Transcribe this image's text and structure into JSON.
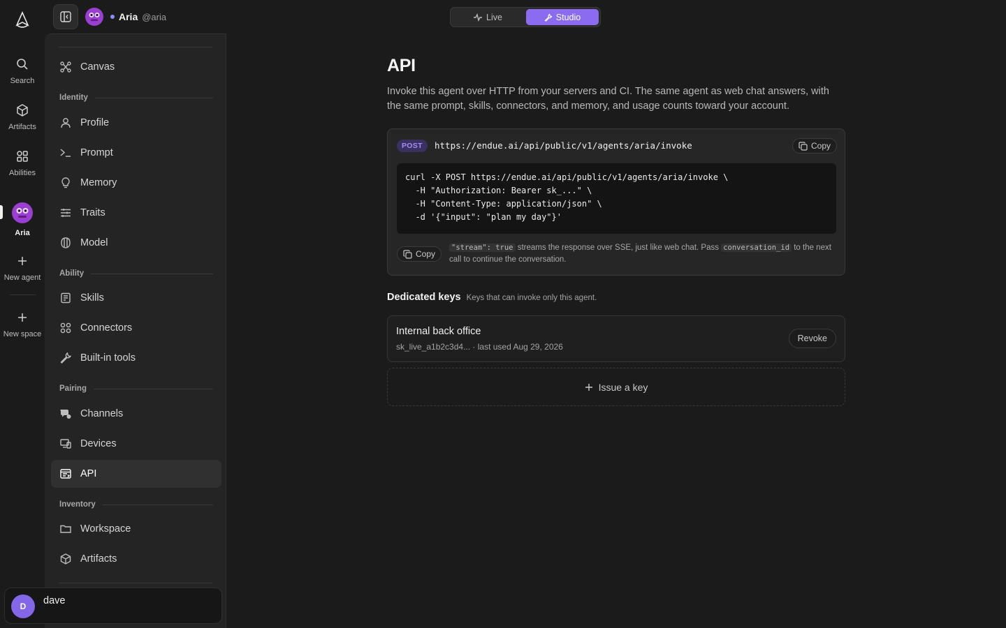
{
  "rail": {
    "items": [
      {
        "label": "Search",
        "icon": "search-icon"
      },
      {
        "label": "Artifacts",
        "icon": "cube-icon"
      },
      {
        "label": "Abilities",
        "icon": "grid-icon"
      },
      {
        "label": "Aria",
        "icon": "agent-avatar"
      },
      {
        "label": "New agent",
        "icon": "plus-icon"
      },
      {
        "label": "New space",
        "icon": "plus-icon"
      }
    ]
  },
  "topbar": {
    "agent_name": "Aria",
    "agent_handle": "@aria",
    "modes": [
      {
        "label": "Live",
        "icon": "pulse-icon"
      },
      {
        "label": "Studio",
        "icon": "wrench-icon"
      }
    ],
    "active_mode": "Studio"
  },
  "sidebar": {
    "canvas": "Canvas",
    "sections": [
      {
        "title": "Identity",
        "items": [
          "Profile",
          "Prompt",
          "Memory",
          "Traits",
          "Model"
        ]
      },
      {
        "title": "Ability",
        "items": [
          "Skills",
          "Connectors",
          "Built-in tools"
        ]
      },
      {
        "title": "Pairing",
        "items": [
          "Channels",
          "Devices",
          "API"
        ]
      },
      {
        "title": "Inventory",
        "items": [
          "Workspace",
          "Artifacts"
        ]
      }
    ],
    "active_item": "API",
    "user": {
      "initial": "D",
      "name": "dave"
    }
  },
  "main": {
    "title": "API",
    "description": "Invoke this agent over HTTP from your servers and CI. The same agent as web chat answers, with the same prompt, skills, connectors, and memory, and usage counts toward your account.",
    "endpoint": {
      "method": "POST",
      "url": "https://endue.ai/api/public/v1/agents/aria/invoke",
      "copy_label": "Copy"
    },
    "code": [
      "curl -X POST https://endue.ai/api/public/v1/agents/aria/invoke \\",
      "  -H \"Authorization: Bearer sk_...\" \\",
      "  -H \"Content-Type: application/json\" \\",
      "  -d '{\"input\": \"plan my day\"}'"
    ],
    "code_copy_label": "Copy",
    "note": {
      "code1": "\"stream\": true",
      "text1": " streams the response over SSE, just like web chat. Pass ",
      "code2": "conversation_id",
      "text2": " to the next call to continue the conversation."
    },
    "keys": {
      "title": "Dedicated keys",
      "subtitle": "Keys that can invoke only this agent.",
      "items": [
        {
          "name": "Internal back office",
          "meta": "sk_live_a1b2c3d4... · last used Aug 29, 2026",
          "action": "Revoke"
        }
      ],
      "issue_label": "Issue a key"
    }
  },
  "colors": {
    "accent": "#8b6cf0",
    "badge_text": "#a48ef5",
    "background": "#1b1b1b",
    "panel": "#242424"
  }
}
